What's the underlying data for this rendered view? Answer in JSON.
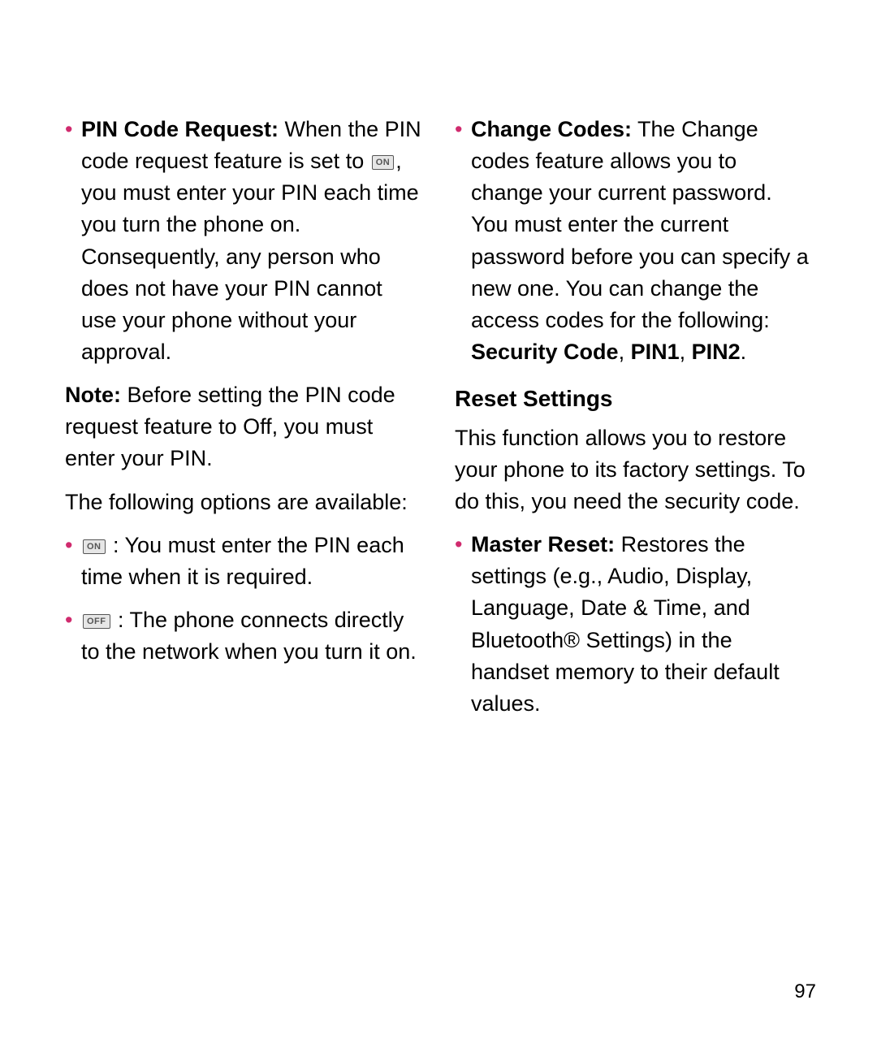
{
  "left": {
    "pin_code_request": {
      "title": "PIN Code Request:",
      "body_before": " When the PIN code request feature is set to ",
      "icon_on": "ON",
      "body_after": ", you must enter your PIN each time you turn the phone on. Consequently, any person who does not have your PIN cannot use your phone without your approval."
    },
    "note": {
      "title": "Note:",
      "body": " Before setting the PIN code request feature to Off, you must enter your PIN."
    },
    "options_intro": "The following options are available:",
    "option_on": {
      "icon": "ON",
      "body": " : You must enter the PIN each time when it is required."
    },
    "option_off": {
      "icon": "OFF",
      "body": " : The phone connects directly to the network when you turn it on."
    }
  },
  "right": {
    "change_codes": {
      "title": "Change Codes:",
      "body": " The Change codes feature allows you to change your current password. You must enter the current password before you can specify a new one. You can change the access codes for the following: ",
      "bold_tail": "Security Code",
      "sep1": ", ",
      "bold_pin1": "PIN1",
      "sep2": ", ",
      "bold_pin2": "PIN2",
      "period": "."
    },
    "reset_heading": "Reset Settings",
    "reset_body": "This function allows you to restore your phone to its factory settings. To do this, you need the security code.",
    "master_reset": {
      "title": "Master Reset:",
      "body": " Restores the settings (e.g., Audio, Display, Language, Date & Time, and Bluetooth® Settings) in the handset memory to their default values."
    }
  },
  "page_number": "97"
}
